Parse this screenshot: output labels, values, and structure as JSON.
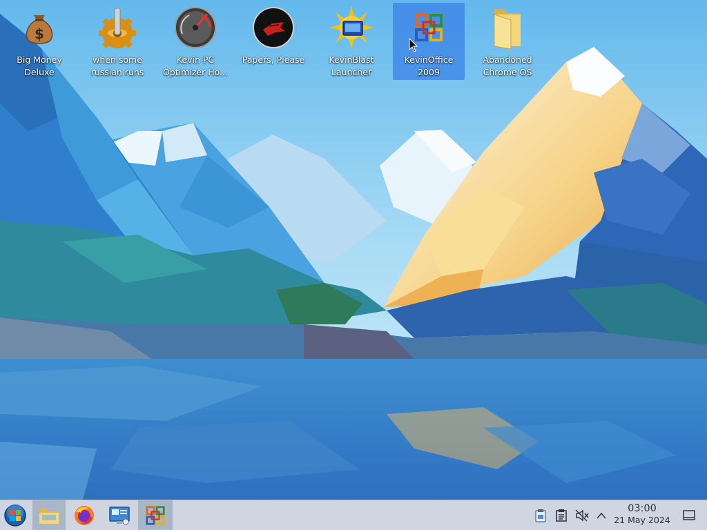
{
  "desktop": {
    "icons": [
      {
        "label": "Big Money\nDeluxe",
        "icon": "money-bag-icon"
      },
      {
        "label": "when some\nrussian runs a...",
        "icon": "gear-lever-icon"
      },
      {
        "label": "Kevin PC\nOptimizer Ho...",
        "icon": "speedometer-icon"
      },
      {
        "label": "Papers, Please",
        "icon": "emblem-icon"
      },
      {
        "label": "KevinBlast\nLauncher",
        "icon": "sun-monitor-icon"
      },
      {
        "label": "KevinOffice\n2009",
        "icon": "office-logo-icon",
        "selected": true
      },
      {
        "label": "Abandoned\nChrome OS",
        "icon": "folder-icon"
      }
    ]
  },
  "taskbar": {
    "start": {
      "icon": "start-orb-icon"
    },
    "apps": [
      {
        "name": "file-manager",
        "icon": "folder-icon"
      },
      {
        "name": "firefox",
        "icon": "firefox-icon"
      },
      {
        "name": "system-info",
        "icon": "monitor-info-icon"
      },
      {
        "name": "kevinoffice",
        "icon": "office-logo-icon",
        "active": true
      }
    ],
    "tray": [
      "clipboard-icon",
      "notes-icon",
      "volume-muted-icon",
      "chevron-up-icon"
    ],
    "clock": {
      "time": "03:00",
      "date": "21 May 2024"
    },
    "show_desktop": {
      "icon": "show-desktop-icon"
    }
  },
  "colors": {
    "selection": "#3d84e8",
    "taskbar": "#cfd6e2",
    "sky": "#79c4f0"
  }
}
